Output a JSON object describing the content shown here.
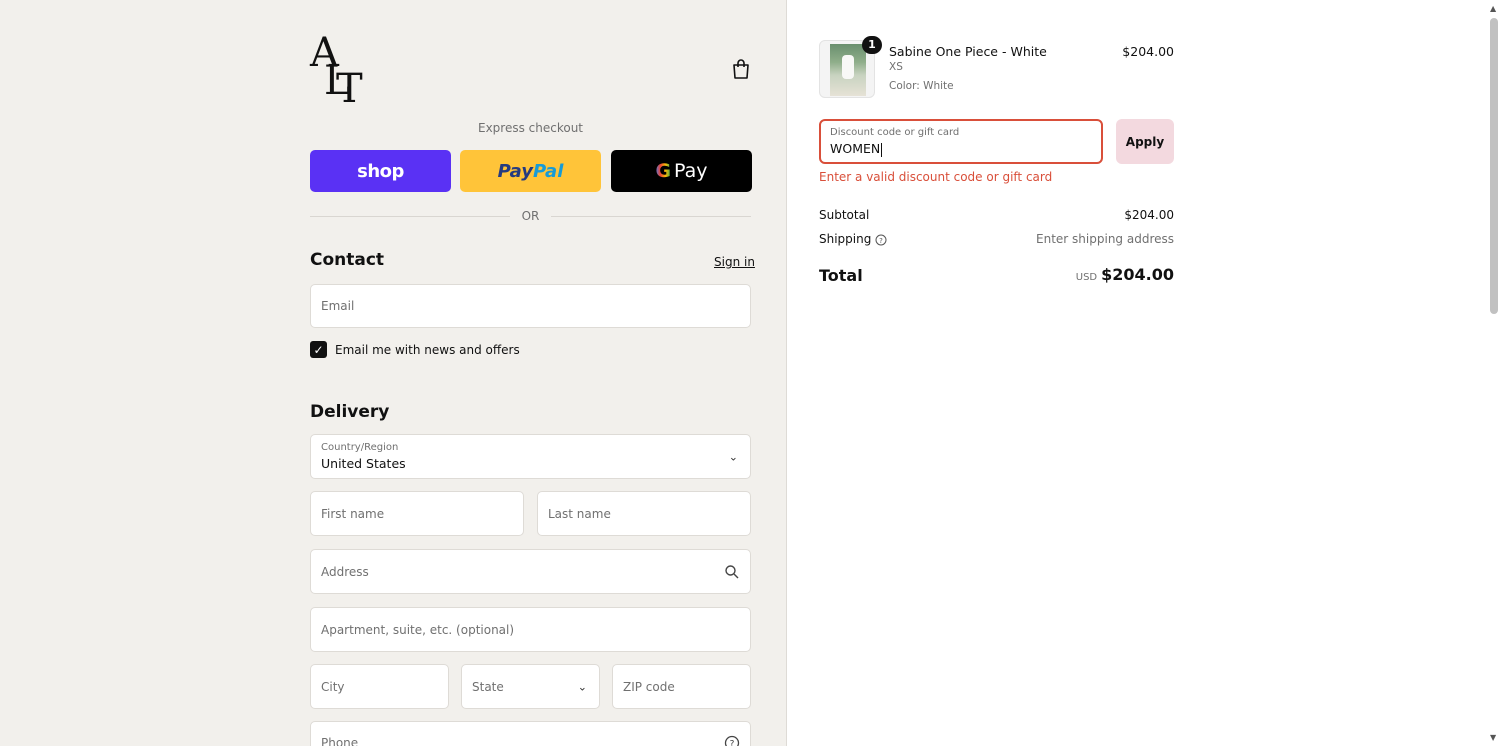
{
  "header": {
    "logo_letters": [
      "A",
      "L",
      "T"
    ],
    "cart_icon": "shopping-bag-icon"
  },
  "express": {
    "label": "Express checkout",
    "shop_label": "shop",
    "paypal_label_1": "Pay",
    "paypal_label_2": "Pal",
    "gpay_g": "G",
    "gpay_label": "Pay",
    "divider": "OR"
  },
  "contact": {
    "title": "Contact",
    "sign_in": "Sign in",
    "email_placeholder": "Email",
    "news_label": "Email me with news and offers",
    "news_checked": true
  },
  "delivery": {
    "title": "Delivery",
    "country_label": "Country/Region",
    "country_value": "United States",
    "first_name": "First name",
    "last_name": "Last name",
    "address": "Address",
    "apartment": "Apartment, suite, etc. (optional)",
    "city": "City",
    "state": "State",
    "zip": "ZIP code",
    "phone": "Phone"
  },
  "order": {
    "item": {
      "quantity": "1",
      "name": "Sabine One Piece - White",
      "size": "XS",
      "color": "Color: White",
      "price": "$204.00"
    },
    "discount_label": "Discount code or gift card",
    "discount_value": "WOMEN",
    "apply": "Apply",
    "error": "Enter a valid discount code or gift card",
    "subtotal_label": "Subtotal",
    "subtotal_value": "$204.00",
    "shipping_label": "Shipping",
    "shipping_value": "Enter shipping address",
    "total_label": "Total",
    "currency": "USD",
    "total_value": "$204.00"
  },
  "colors": {
    "shop": "#5a31f4",
    "paypal": "#ffc439",
    "error": "#d94f3a",
    "apply_bg": "#f3d9df"
  }
}
